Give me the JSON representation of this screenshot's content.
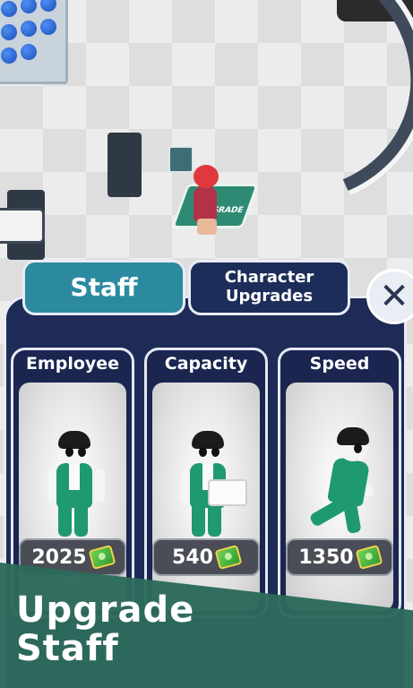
{
  "tabs": {
    "staff_label": "Staff",
    "character_upgrades_label": "Character Upgrades"
  },
  "close_icon": "close-icon",
  "floor_pad_text": "GRADE",
  "cards": [
    {
      "title": "Employee",
      "price": "2025",
      "icon": "cash-icon"
    },
    {
      "title": "Capacity",
      "price": "540",
      "icon": "cash-icon"
    },
    {
      "title": "Speed",
      "price": "1350",
      "icon": "cash-icon"
    }
  ],
  "banner": {
    "line1": "Upgrade",
    "line2": "Staff"
  },
  "colors": {
    "panel": "#1e2b56",
    "active_tab": "#2b8aa0",
    "banner": "#2c6a5c",
    "uniform": "#1f9a6e"
  }
}
